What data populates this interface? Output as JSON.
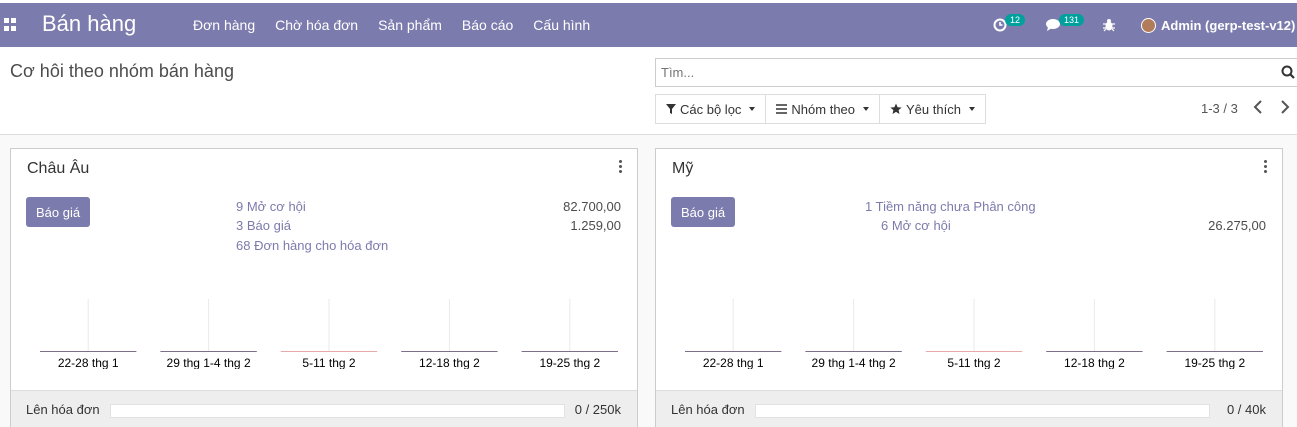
{
  "navbar": {
    "app_title": "Bán hàng",
    "menu": [
      "Đơn hàng",
      "Chờ hóa đơn",
      "Sản phẩm",
      "Báo cáo",
      "Cấu hình"
    ],
    "activity_count": "12",
    "message_count": "131",
    "user_name": "Admin (gerp-test-v12)",
    "bg_color": "#7c7bad"
  },
  "control_panel": {
    "title": "Cơ hôi theo nhóm bán hàng",
    "search_placeholder": "Tìm...",
    "filters_label": "Các bộ lọc",
    "group_by_label": "Nhóm theo",
    "favorites_label": "Yêu thích",
    "pager": "1-3 / 3"
  },
  "teams": [
    {
      "name": "Châu Âu",
      "button_label": "Báo giá",
      "stats": [
        {
          "label": "9 Mở cơ hội",
          "value": "82.700,00"
        },
        {
          "label": "3 Báo giá",
          "value": "1.259,00"
        },
        {
          "label": "68 Đơn hàng cho hóa đơn",
          "value": ""
        }
      ],
      "chart_data": {
        "type": "bar",
        "categories": [
          "22-28 thg 1",
          "29 thg 1-4 thg 2",
          "5-11 thg 2",
          "12-18 thg 2",
          "19-25 thg 2"
        ],
        "values": [
          0,
          0,
          0,
          0,
          0
        ]
      },
      "invoice_label": "Lên hóa đơn",
      "invoice_progress": "0 / 250k",
      "invoice_fraction": 0
    },
    {
      "name": "Mỹ",
      "button_label": "Báo giá",
      "stats": [
        {
          "label": "1 Tiềm năng chưa Phân công",
          "value": ""
        },
        {
          "label": "6 Mở cơ hội",
          "value": "26.275,00"
        }
      ],
      "chart_data": {
        "type": "bar",
        "categories": [
          "22-28 thg 1",
          "29 thg 1-4 thg 2",
          "5-11 thg 2",
          "12-18 thg 2",
          "19-25 thg 2"
        ],
        "values": [
          0,
          0,
          0,
          0,
          0
        ]
      },
      "invoice_label": "Lên hóa đơn",
      "invoice_progress": "0 / 40k",
      "invoice_fraction": 0
    }
  ]
}
